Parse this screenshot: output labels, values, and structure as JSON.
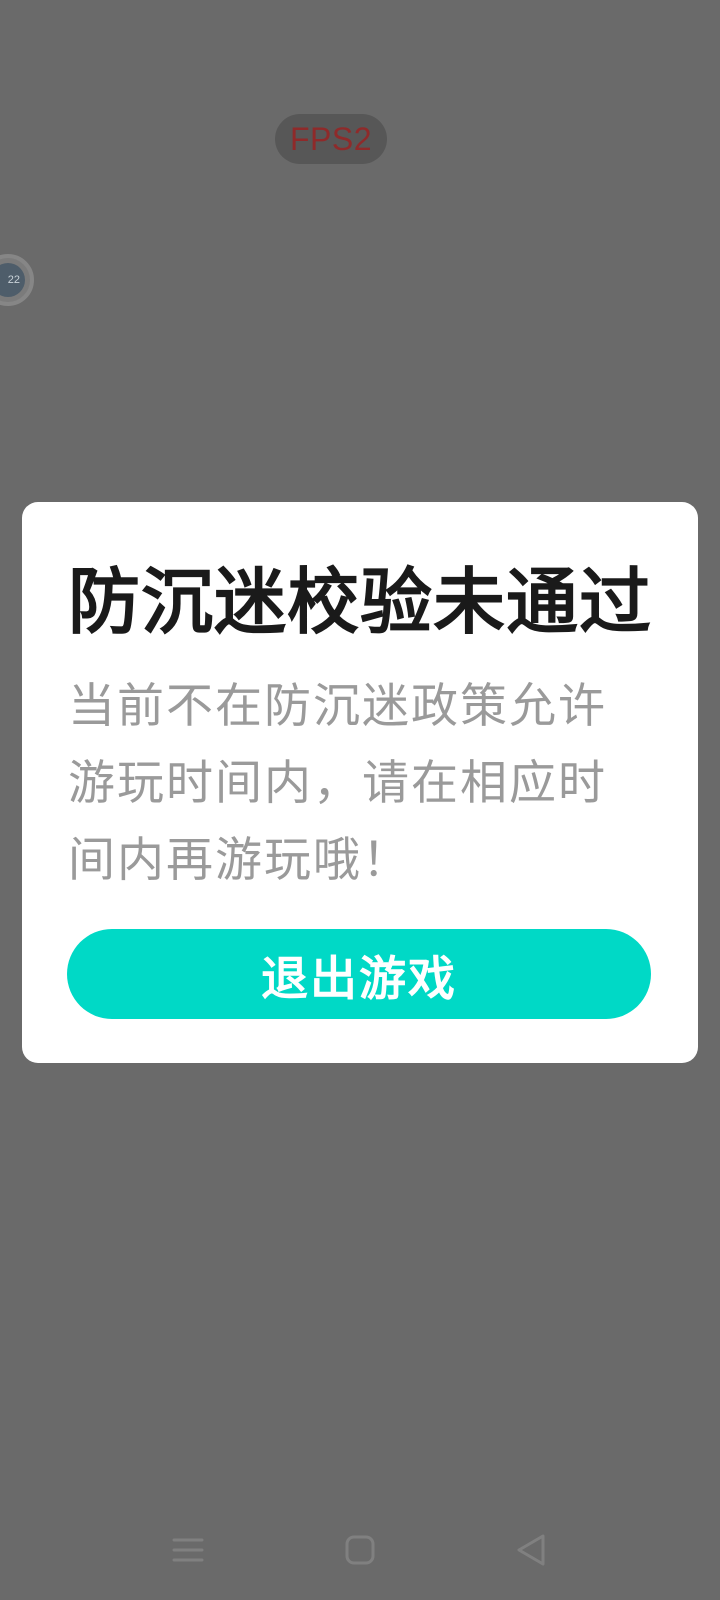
{
  "overlay": {
    "fps_label": "FPS2",
    "float_ball_text": "22"
  },
  "dialog": {
    "title": "防沉迷校验未通过",
    "message": "当前不在防沉迷政策允许游玩时间内，请在相应时间内再游玩哦！",
    "exit_button_label": "退出游戏",
    "accent_color": "#00d9c6"
  },
  "navbar": {
    "menu_icon": "menu-icon",
    "home_icon": "home-icon",
    "back_icon": "back-icon"
  }
}
